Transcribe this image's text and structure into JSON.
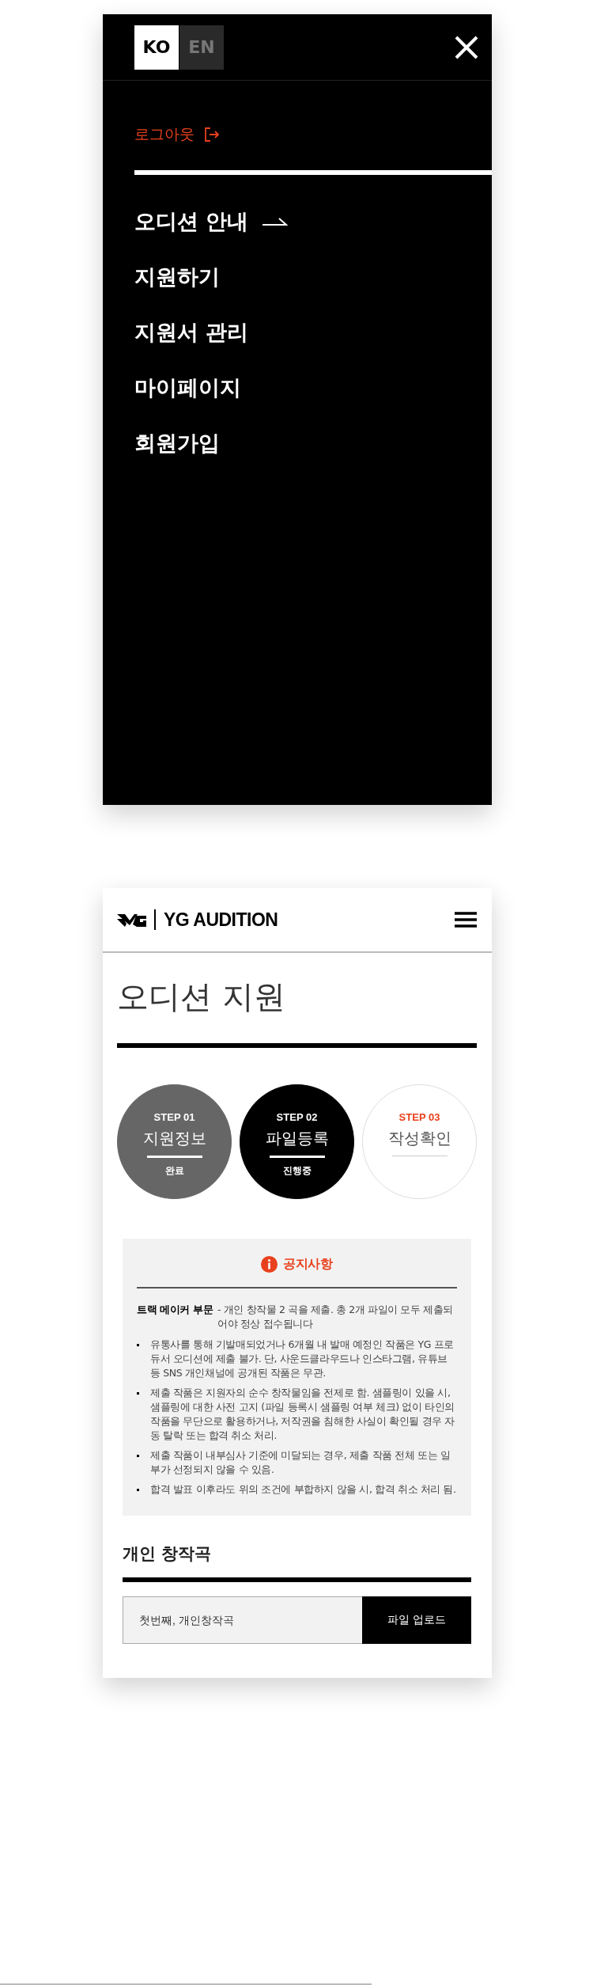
{
  "menu_panel": {
    "languages": [
      {
        "label": "KO",
        "selected": true
      },
      {
        "label": "EN",
        "selected": false
      }
    ],
    "logout": "로그아웃",
    "nav": [
      {
        "label": "오디션 안내",
        "selected": true
      },
      {
        "label": "지원하기",
        "selected": false
      },
      {
        "label": "지원서 관리",
        "selected": false
      },
      {
        "label": "마이페이지",
        "selected": false
      },
      {
        "label": "회원가입",
        "selected": false
      }
    ]
  },
  "app_panel": {
    "brand": "YG AUDITION",
    "title": "오디션 지원",
    "steps": [
      {
        "step": "STEP 01",
        "label": "지원정보",
        "status": "완료",
        "kind": "done"
      },
      {
        "step": "STEP 02",
        "label": "파일등록",
        "status": "진행중",
        "kind": "current"
      },
      {
        "step": "STEP 03",
        "label": "작성확인",
        "kind": "pending"
      }
    ],
    "notice": {
      "title": "공지사항",
      "lead_label": "트랙 메이커 부문",
      "lead_text": "- 개인 창작물 2 곡을 제출. 총 2개 파일이 모두 제출되어야 정상 접수됩니다",
      "items": [
        "유통사를 통해 기발매되었거나 6개월 내 발매 예정인 작품은 YG 프로듀서 오디션에 제출 불가. 단, 사운드클라우드나 인스타그램, 유튜브 등 SNS 개인채널에 공개된 작품은 무관.",
        "제출 작품은 지원자의 순수 창작물임을 전제로 함. 샘플링이 있을 시, 샘플링에 대한 사전 고지 (파일 등록시 샘플링 여부 체크) 없이 타인의 작품을 무단으로 활용하거나, 저작권을 침해한 사실이 확인될 경우 자동 탈락 또는 합격 취소 처리.",
        "제출 작품이 내부심사 기준에 미달되는 경우, 제출 작품 전체 또는 일부가 선정되지 않을 수 있음.",
        "합격 발표 이후라도 위의 조건에 부합하지 않을 시, 합격 취소 처리 됨."
      ]
    },
    "section": {
      "title": "개인 창작곡",
      "file_field": {
        "placeholder": "첫번째, 개인창작곡"
      },
      "upload_button": "파일 업로드"
    }
  }
}
